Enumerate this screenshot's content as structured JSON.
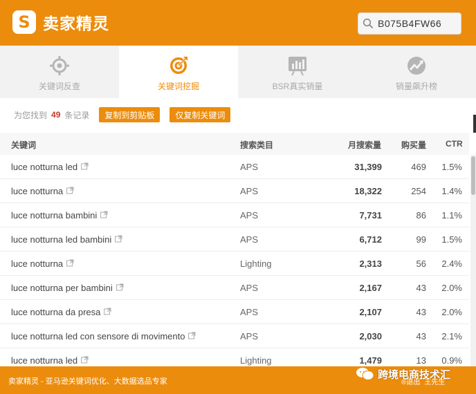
{
  "header": {
    "logo_mark": "S",
    "logo_text": "卖家精灵",
    "search_value": "B075B4FW66",
    "brand_color": "#ec8c0c"
  },
  "tabs": [
    {
      "label": "关键词反查",
      "icon": "target-icon",
      "active": false
    },
    {
      "label": "关键词挖掘",
      "icon": "bullseye-arrow-icon",
      "active": true
    },
    {
      "label": "BSR真实销量",
      "icon": "bar-chart-icon",
      "active": false
    },
    {
      "label": "销量飙升榜",
      "icon": "trend-up-icon",
      "active": false
    }
  ],
  "summary": {
    "prefix": "为您找到",
    "count": "49",
    "suffix": "条记录",
    "copy_all_label": "复制到剪贴板",
    "copy_keywords_label": "仅复制关键词"
  },
  "table": {
    "headers": {
      "keyword": "关键词",
      "category": "搜索类目",
      "volume": "月搜索量",
      "purchases": "购买量",
      "ctr": "CTR"
    },
    "rows": [
      {
        "keyword": "luce notturna led",
        "category": "APS",
        "volume": "31,399",
        "purchases": "469",
        "ctr": "1.5%"
      },
      {
        "keyword": "luce notturna",
        "category": "APS",
        "volume": "18,322",
        "purchases": "254",
        "ctr": "1.4%"
      },
      {
        "keyword": "luce notturna bambini",
        "category": "APS",
        "volume": "7,731",
        "purchases": "86",
        "ctr": "1.1%"
      },
      {
        "keyword": "luce notturna led bambini",
        "category": "APS",
        "volume": "6,712",
        "purchases": "99",
        "ctr": "1.5%"
      },
      {
        "keyword": "luce notturna",
        "category": "Lighting",
        "volume": "2,313",
        "purchases": "56",
        "ctr": "2.4%"
      },
      {
        "keyword": "luce notturna per bambini",
        "category": "APS",
        "volume": "2,167",
        "purchases": "43",
        "ctr": "2.0%"
      },
      {
        "keyword": "luce notturna da presa",
        "category": "APS",
        "volume": "2,107",
        "purchases": "43",
        "ctr": "2.0%"
      },
      {
        "keyword": "luce notturna led con sensore di movimento",
        "category": "APS",
        "volume": "2,030",
        "purchases": "43",
        "ctr": "2.1%"
      },
      {
        "keyword": "luce notturna led",
        "category": "Lighting",
        "volume": "1,479",
        "purchases": "13",
        "ctr": "0.9%"
      }
    ]
  },
  "footer": {
    "text": "卖家精灵 - 亚马逊关键词优化、大数据选品专家",
    "watermark": "跨境电商技术汇",
    "user_left": "®退出",
    "user_right": "王先生"
  }
}
